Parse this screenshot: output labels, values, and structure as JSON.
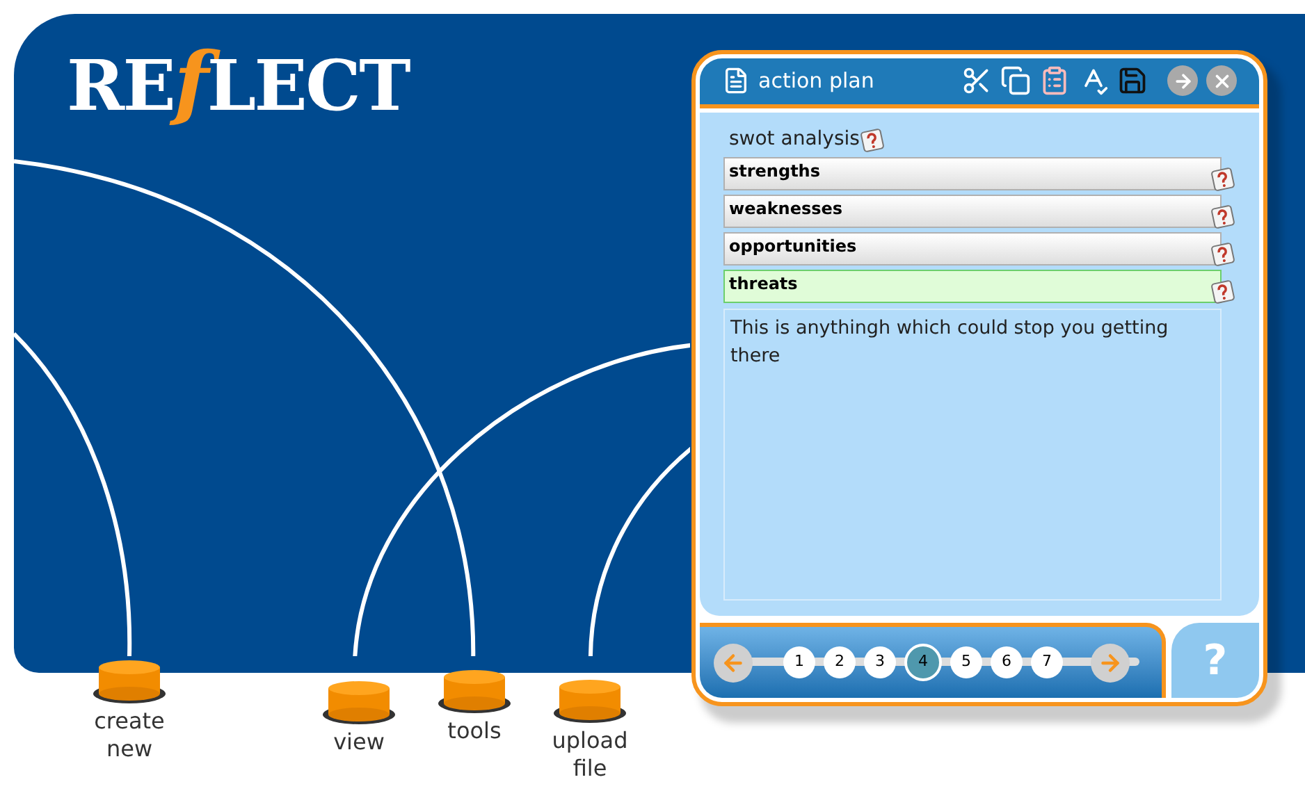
{
  "logo": {
    "before": "RE",
    "accent": "f",
    "after": "LECT"
  },
  "nav": [
    {
      "label": "create new"
    },
    {
      "label": "view"
    },
    {
      "label": "tools"
    },
    {
      "label": "upload file"
    }
  ],
  "panel": {
    "title": "action plan",
    "section": "swot analysis",
    "items": [
      {
        "label": "strengths",
        "selected": false
      },
      {
        "label": "weaknesses",
        "selected": false
      },
      {
        "label": "opportunities",
        "selected": false
      },
      {
        "label": "threats",
        "selected": true
      }
    ],
    "description": "This is anythingh which could stop you getting there",
    "pages": [
      {
        "label": "1",
        "selected": false
      },
      {
        "label": "2",
        "selected": false
      },
      {
        "label": "3",
        "selected": false
      },
      {
        "label": "4",
        "selected": true
      },
      {
        "label": "5",
        "selected": false
      },
      {
        "label": "6",
        "selected": false
      },
      {
        "label": "7",
        "selected": false
      }
    ],
    "help_tab": "?"
  }
}
